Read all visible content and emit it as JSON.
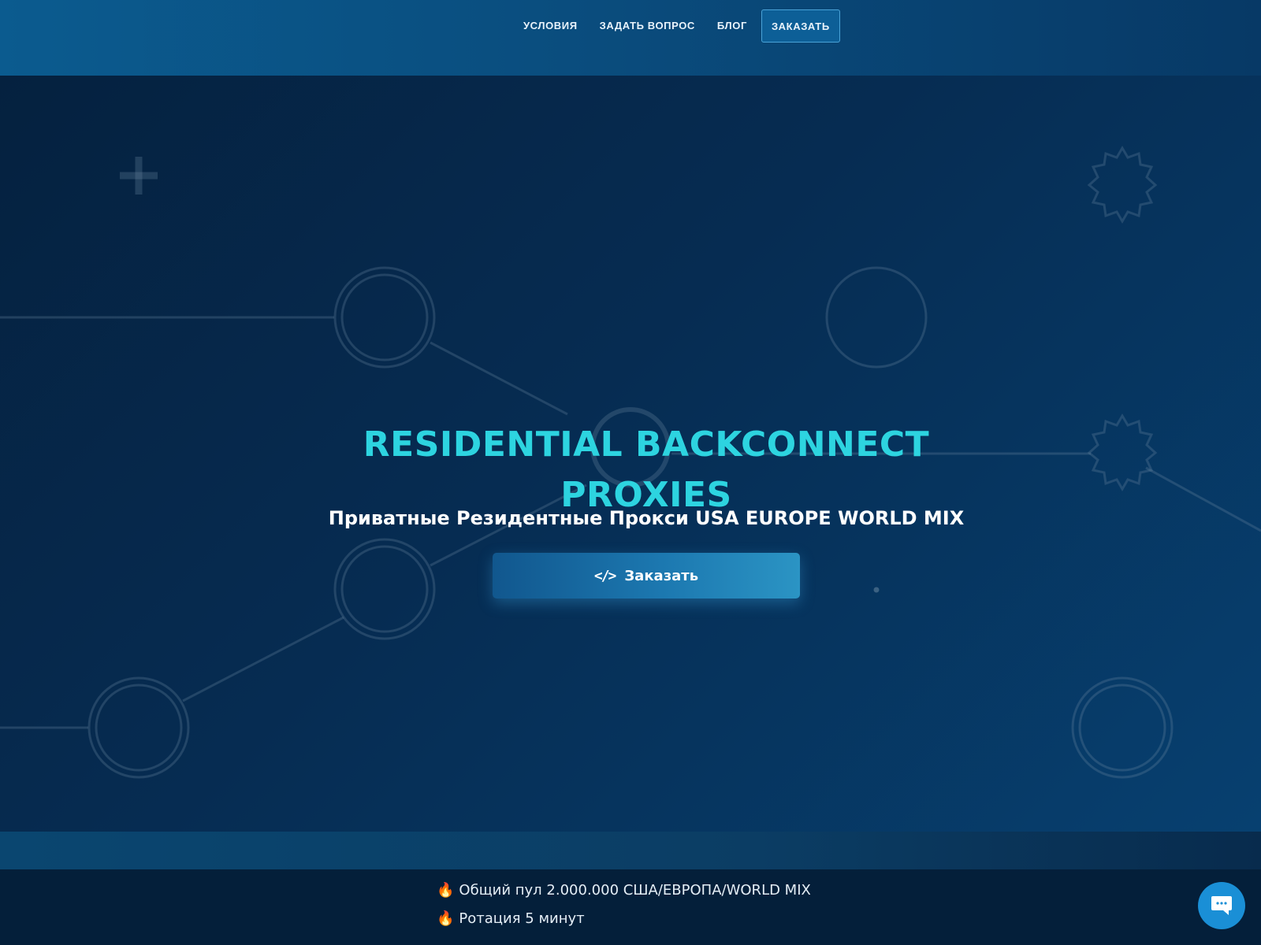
{
  "nav": {
    "items": [
      {
        "label": "УСЛОВИЯ"
      },
      {
        "label": "ЗАДАТЬ ВОПРОС"
      },
      {
        "label": "БЛОГ"
      }
    ],
    "cta_label": "ЗАКАЗАТЬ"
  },
  "hero": {
    "title_line1": "RESIDENTIAL BACKCONNECT",
    "title_line2": "PROXIES",
    "subtitle": "Приватные Резидентные Прокси USA EUROPE WORLD MIX",
    "button_label": "Заказать",
    "button_icon": "code-icon"
  },
  "features": {
    "items": [
      {
        "icon": "fire-icon",
        "text": "Общий пул 2.000.000 США/ЕВРОПА/WORLD MIX"
      },
      {
        "icon": "fire-icon",
        "text": "Ротация 5 минут"
      }
    ]
  },
  "chat": {
    "icon": "chat-bubble-icon"
  },
  "colors": {
    "accent_title": "#2dd4e0",
    "hero_bg": "#062c52",
    "button": "#1c78b0",
    "chat": "#1a8fd6"
  }
}
